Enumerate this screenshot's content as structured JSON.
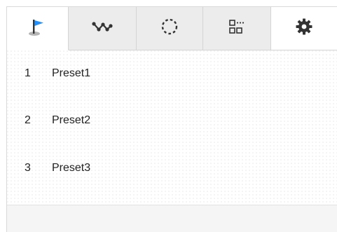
{
  "tabs": [
    {
      "id": "preset",
      "icon": "flag-icon",
      "active": true
    },
    {
      "id": "tour",
      "icon": "zigzag-path-icon",
      "active": false
    },
    {
      "id": "pattern",
      "icon": "dotted-circle-icon",
      "active": false
    },
    {
      "id": "scan",
      "icon": "grid-squares-icon",
      "active": false
    },
    {
      "id": "settings",
      "icon": "gear-icon",
      "active": false
    }
  ],
  "colors": {
    "flag_blue": "#1e90ff",
    "icon_dark": "#333333",
    "flag_base": "#b0b0b0"
  },
  "presets": [
    {
      "number": "1",
      "name": "Preset1"
    },
    {
      "number": "2",
      "name": "Preset2"
    },
    {
      "number": "3",
      "name": "Preset3"
    }
  ]
}
